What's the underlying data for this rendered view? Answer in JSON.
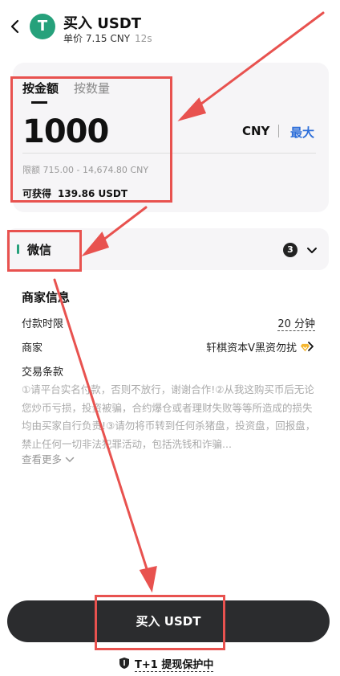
{
  "header": {
    "title": "买入 USDT",
    "unit_price": "单价 7.15 CNY",
    "timer": "12s",
    "logo_glyph": "T"
  },
  "amount_card": {
    "tabs": [
      {
        "label": "按金额",
        "active": true
      },
      {
        "label": "按数量",
        "active": false
      }
    ],
    "amount_value": "1000",
    "currency": "CNY",
    "max_label": "最大",
    "limit_text": "限额 715.00 - 14,674.80 CNY",
    "receive_label": "可获得",
    "receive_value": "139.86 USDT"
  },
  "payment": {
    "method": "微信",
    "count": "3"
  },
  "merchant_info": {
    "title": "商家信息",
    "rows": [
      {
        "label": "付款时限",
        "value": "20 分钟"
      },
      {
        "label": "商家",
        "value": "轩棋资本V黑资勿扰"
      }
    ],
    "terms_label": "交易条款",
    "terms_text": "①请平台实名付款，否则不放行，谢谢合作!②从我这购买币后无论您炒币亏损，投资被骗，合约爆仓或者理财失败等等所造成的损失均由买家自行负责!③请勿将币转到任何杀猪盘，投资盘，回报盘，禁止任何一切非法犯罪活动，包括洗钱和诈骗...",
    "see_more": "查看更多"
  },
  "footer": {
    "buy_label": "买入 USDT",
    "protection": "T+1 提现保护中"
  },
  "colors": {
    "accent_blue": "#2e6fd9",
    "tether_green": "#26a17b",
    "annotation_red": "#e8524f",
    "button_dark": "#2b2c2e"
  }
}
